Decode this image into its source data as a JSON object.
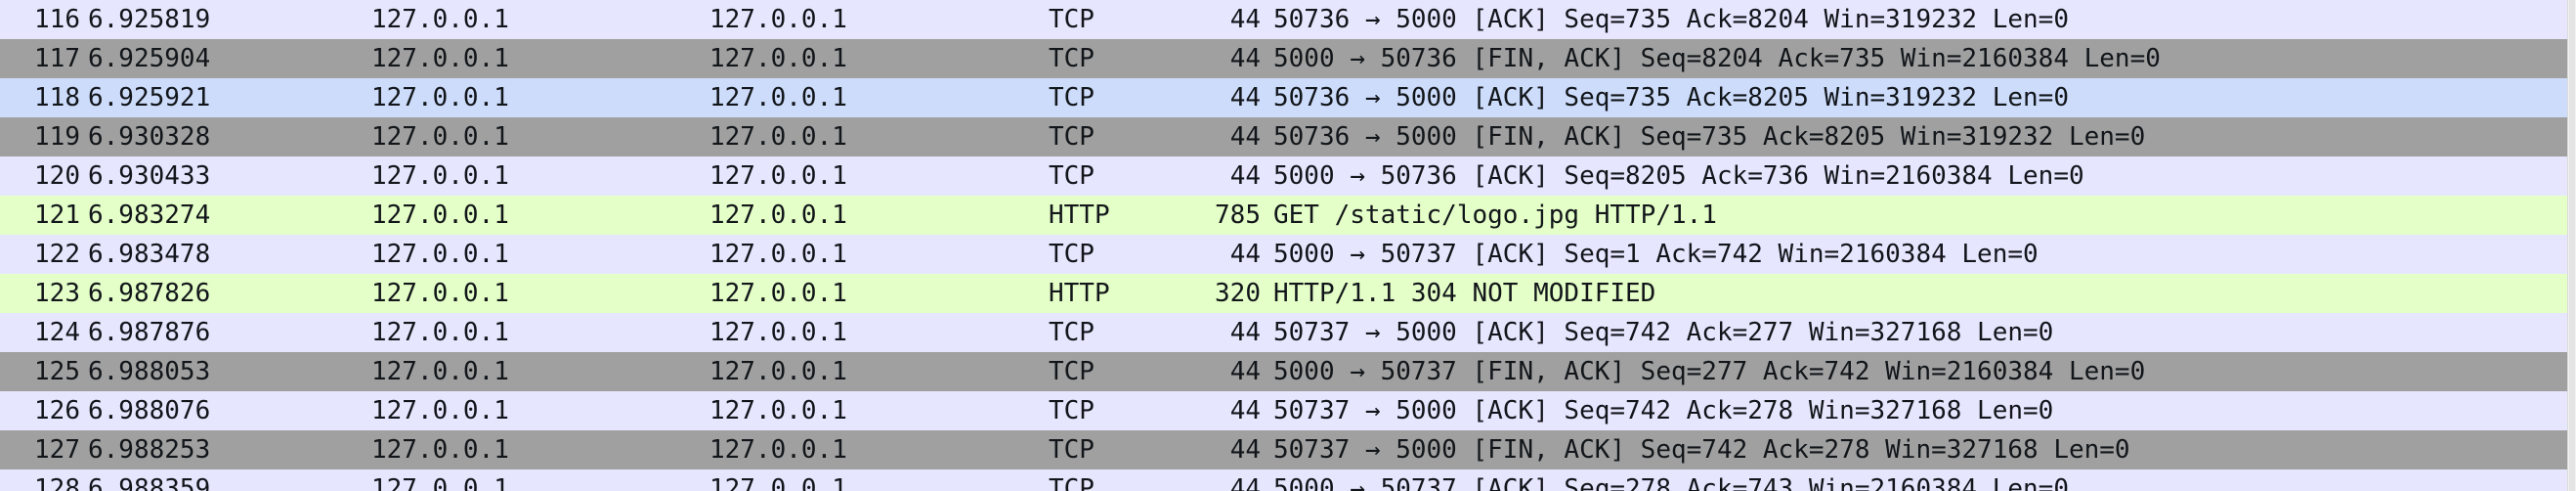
{
  "packets": [
    {
      "no": "116",
      "time": "6.925819",
      "src": "127.0.0.1",
      "dst": "127.0.0.1",
      "proto": "TCP",
      "len": "44",
      "info": "50736 → 5000 [ACK] Seq=735 Ack=8204 Win=319232 Len=0",
      "bg": "#e7e6ff"
    },
    {
      "no": "117",
      "time": "6.925904",
      "src": "127.0.0.1",
      "dst": "127.0.0.1",
      "proto": "TCP",
      "len": "44",
      "info": "5000 → 50736 [FIN, ACK] Seq=8204 Ack=735 Win=2160384 Len=0",
      "bg": "#a0a0a0"
    },
    {
      "no": "118",
      "time": "6.925921",
      "src": "127.0.0.1",
      "dst": "127.0.0.1",
      "proto": "TCP",
      "len": "44",
      "info": "50736 → 5000 [ACK] Seq=735 Ack=8205 Win=319232 Len=0",
      "bg": "#cddcfb"
    },
    {
      "no": "119",
      "time": "6.930328",
      "src": "127.0.0.1",
      "dst": "127.0.0.1",
      "proto": "TCP",
      "len": "44",
      "info": "50736 → 5000 [FIN, ACK] Seq=735 Ack=8205 Win=319232 Len=0",
      "bg": "#a0a0a0"
    },
    {
      "no": "120",
      "time": "6.930433",
      "src": "127.0.0.1",
      "dst": "127.0.0.1",
      "proto": "TCP",
      "len": "44",
      "info": "5000 → 50736 [ACK] Seq=8205 Ack=736 Win=2160384 Len=0",
      "bg": "#e7e6ff"
    },
    {
      "no": "121",
      "time": "6.983274",
      "src": "127.0.0.1",
      "dst": "127.0.0.1",
      "proto": "HTTP",
      "len": "785",
      "info": "GET /static/logo.jpg HTTP/1.1",
      "bg": "#e4ffc7"
    },
    {
      "no": "122",
      "time": "6.983478",
      "src": "127.0.0.1",
      "dst": "127.0.0.1",
      "proto": "TCP",
      "len": "44",
      "info": "5000 → 50737 [ACK] Seq=1 Ack=742 Win=2160384 Len=0",
      "bg": "#e7e6ff"
    },
    {
      "no": "123",
      "time": "6.987826",
      "src": "127.0.0.1",
      "dst": "127.0.0.1",
      "proto": "HTTP",
      "len": "320",
      "info": "HTTP/1.1 304 NOT MODIFIED",
      "bg": "#e4ffc7"
    },
    {
      "no": "124",
      "time": "6.987876",
      "src": "127.0.0.1",
      "dst": "127.0.0.1",
      "proto": "TCP",
      "len": "44",
      "info": "50737 → 5000 [ACK] Seq=742 Ack=277 Win=327168 Len=0",
      "bg": "#e7e6ff"
    },
    {
      "no": "125",
      "time": "6.988053",
      "src": "127.0.0.1",
      "dst": "127.0.0.1",
      "proto": "TCP",
      "len": "44",
      "info": "5000 → 50737 [FIN, ACK] Seq=277 Ack=742 Win=2160384 Len=0",
      "bg": "#a0a0a0"
    },
    {
      "no": "126",
      "time": "6.988076",
      "src": "127.0.0.1",
      "dst": "127.0.0.1",
      "proto": "TCP",
      "len": "44",
      "info": "50737 → 5000 [ACK] Seq=742 Ack=278 Win=327168 Len=0",
      "bg": "#e7e6ff"
    },
    {
      "no": "127",
      "time": "6.988253",
      "src": "127.0.0.1",
      "dst": "127.0.0.1",
      "proto": "TCP",
      "len": "44",
      "info": "50737 → 5000 [FIN, ACK] Seq=742 Ack=278 Win=327168 Len=0",
      "bg": "#a0a0a0"
    },
    {
      "no": "128",
      "time": "6.988359",
      "src": "127.0.0.1",
      "dst": "127.0.0.1",
      "proto": "TCP",
      "len": "44",
      "info": "5000 → 50737 [ACK] Seq=278 Ack=743 Win=2160384 Len=0",
      "bg": "#e7e6ff"
    }
  ]
}
